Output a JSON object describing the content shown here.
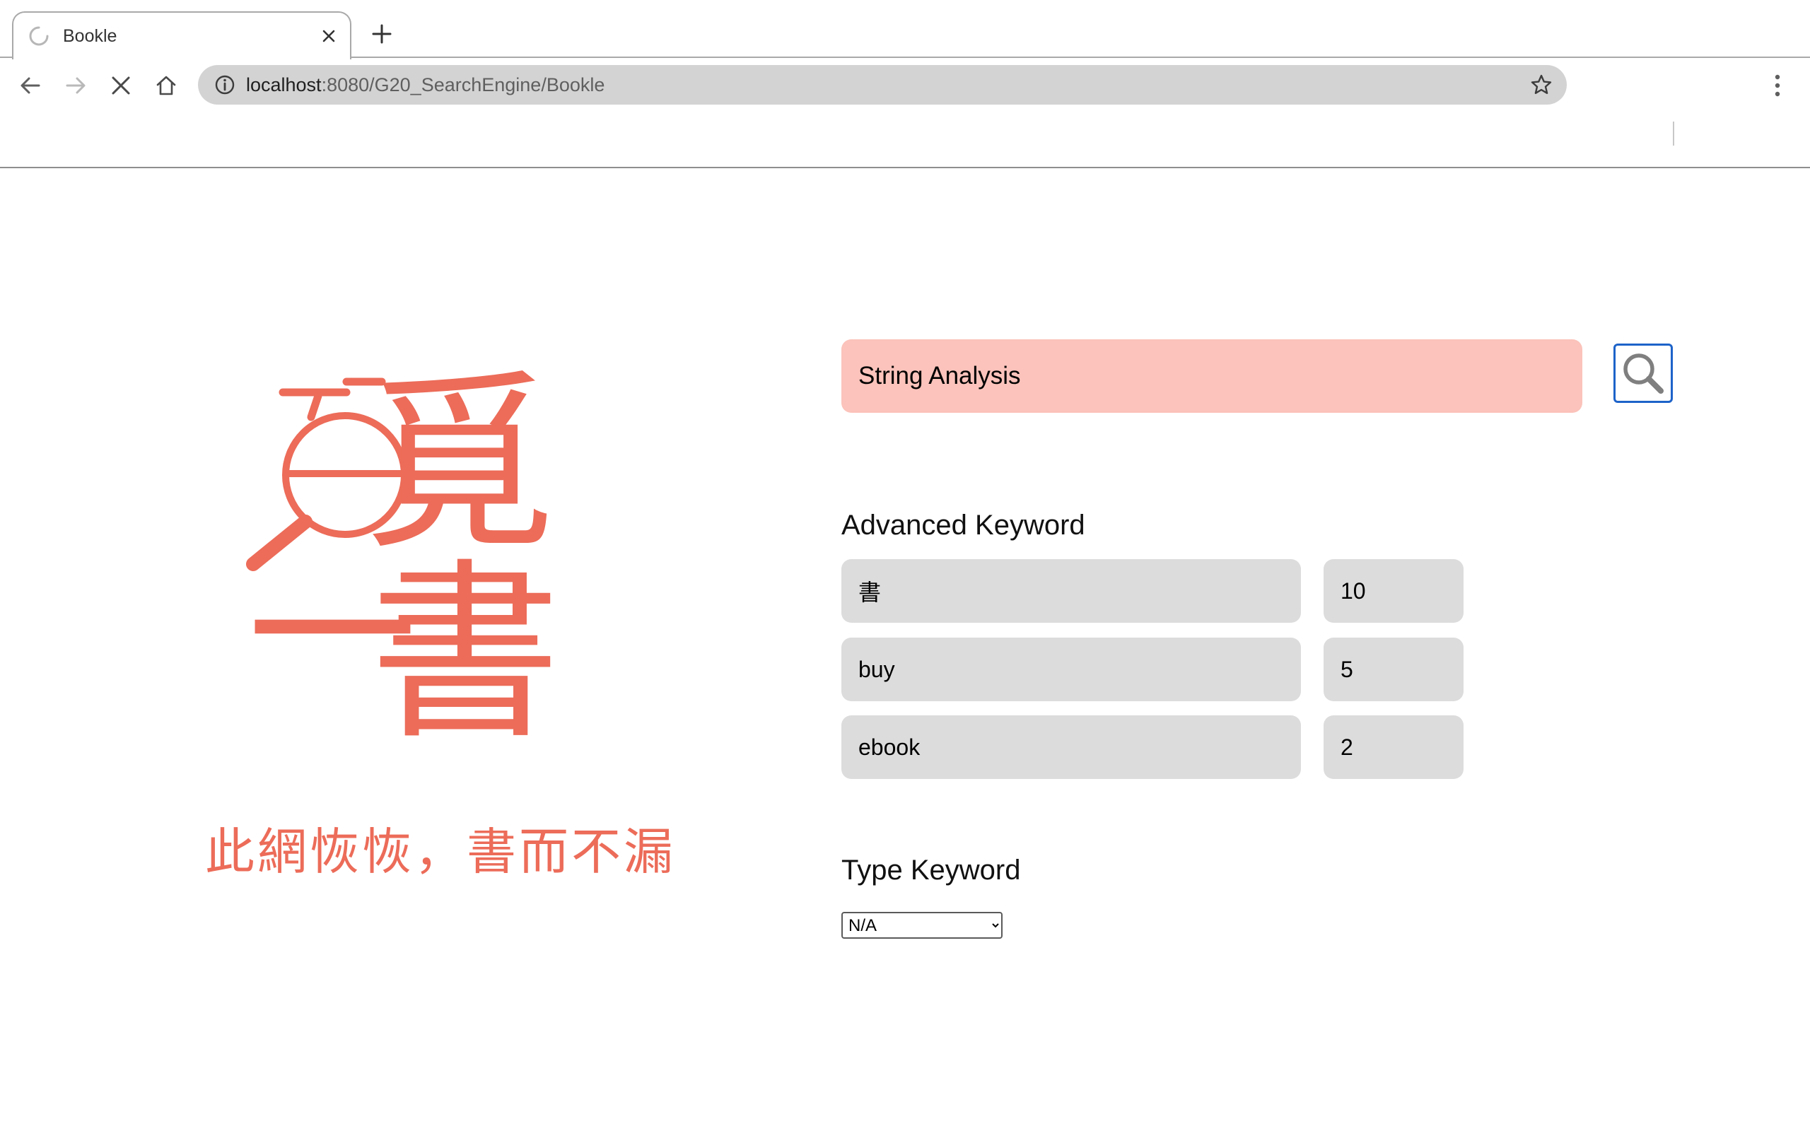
{
  "browser": {
    "tab_title": "Bookle",
    "url_host": "localhost",
    "url_rest": ":8080/G20_SearchEngine/Bookle"
  },
  "logo": {
    "glyph_1": "覓",
    "glyph_2": "一",
    "glyph_3": "書",
    "slogan": "此網恢恢，書而不漏",
    "color": "#ec6c59"
  },
  "search": {
    "query": "String Analysis",
    "input_color": "#fbc3bb"
  },
  "advanced": {
    "label": "Advanced Keyword",
    "rows": [
      {
        "keyword": "書",
        "weight": "10"
      },
      {
        "keyword": "buy",
        "weight": "5"
      },
      {
        "keyword": "ebook",
        "weight": "2"
      }
    ]
  },
  "type": {
    "label": "Type Keyword",
    "selected": "N/A"
  }
}
